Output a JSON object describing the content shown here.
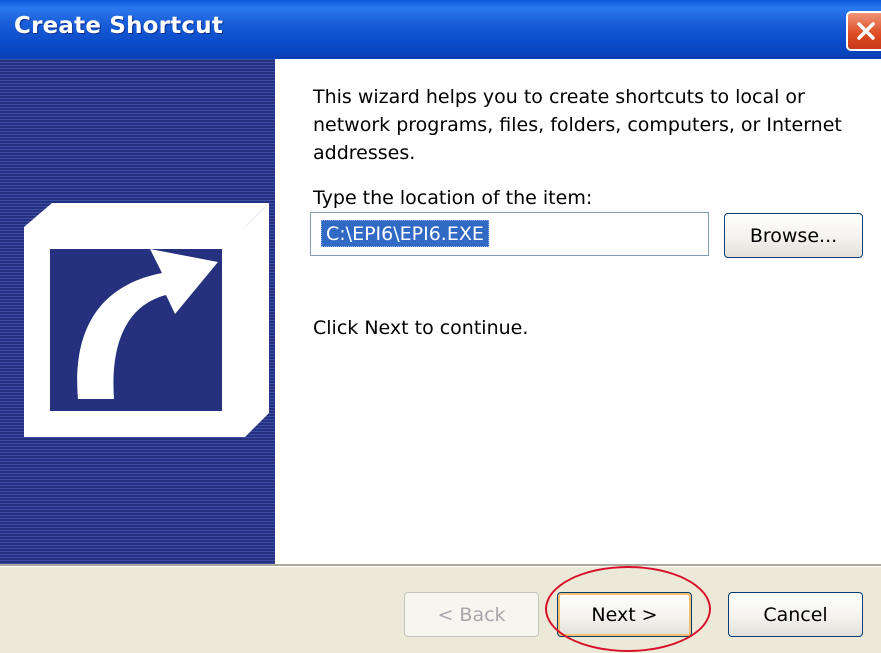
{
  "window": {
    "title": "Create Shortcut"
  },
  "intro_text": "This wizard helps you to create shortcuts to local or network programs, files, folders, computers, or Internet addresses.",
  "location_label": "Type the location of the item:",
  "location_value": "C:\\EPI6\\EPI6.EXE",
  "continue_text": "Click Next to continue.",
  "buttons": {
    "browse": "Browse...",
    "back": "< Back",
    "next": "Next >",
    "cancel": "Cancel"
  },
  "icons": {
    "close": "close-icon",
    "sidebar": "shortcut-arrow-icon"
  },
  "colors": {
    "titlebar": "#0a4fcf",
    "sidebar": "#2c3a8e",
    "selection": "#316ac5",
    "annotation": "#d9102a"
  }
}
